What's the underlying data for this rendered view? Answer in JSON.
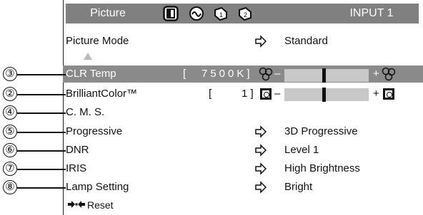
{
  "tabs": {
    "picture": "Picture",
    "input": "INPUT 1",
    "icons": [
      "picture-tab-icon",
      "audio-tab-icon",
      "setup-tab-icon",
      "options-tab-icon"
    ]
  },
  "menu": {
    "picture_mode": {
      "label": "Picture Mode",
      "value": "Standard"
    },
    "clr_temp": {
      "label": "CLR Temp",
      "bracket_open": "[",
      "value": "7500K]",
      "minus": "–",
      "plus": "+"
    },
    "brilliant": {
      "label": "BrilliantColor™",
      "bracket_open": "[",
      "value": "1 ]",
      "minus": "–",
      "plus": "+"
    },
    "cms": {
      "label": "C. M. S."
    },
    "progressive": {
      "label": "Progressive",
      "value": "3D Progressive"
    },
    "dnr": {
      "label": "DNR",
      "value": "Level 1"
    },
    "iris": {
      "label": "IRIS",
      "value": "High Brightness"
    },
    "lamp": {
      "label": "Lamp Setting",
      "value": "Bright"
    },
    "reset": {
      "label": "Reset"
    }
  },
  "callouts": [
    "③",
    "②",
    "④",
    "⑤",
    "⑥",
    "⑦",
    "⑧"
  ],
  "sliders": {
    "clr_temp_level": 0.45,
    "brilliant_level": 0.45
  },
  "colors": {
    "tab_bg": "#808080",
    "highlight": "#8a8a8a",
    "track": "#c8c8c8"
  }
}
